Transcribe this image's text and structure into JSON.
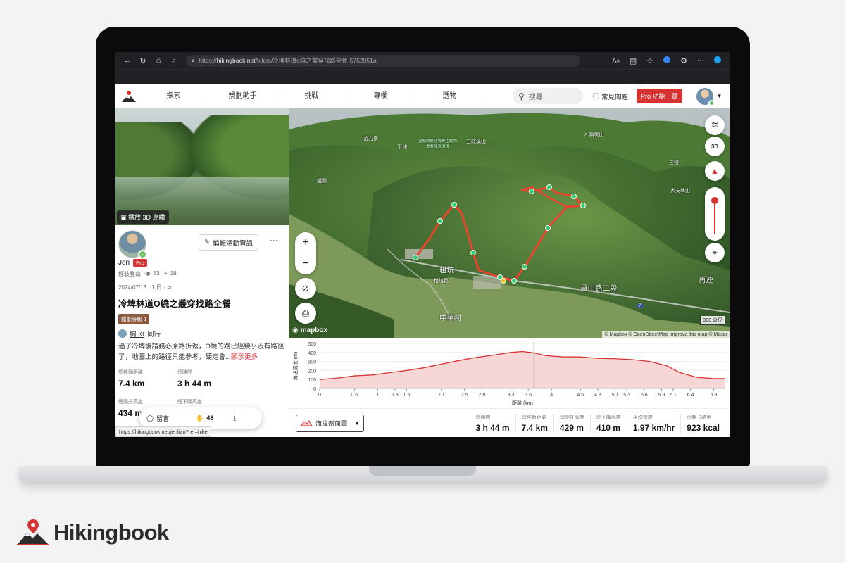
{
  "browser": {
    "url_prefix": "https://",
    "url_host": "hikingbook.net",
    "url_path": "/hikes/冷埤林道o繞之叢穿找路全餐-5752951a",
    "icons": [
      "back-icon",
      "reload-icon",
      "home-icon",
      "search-icon",
      "lock-icon",
      "read-aloud-icon",
      "immersive-reader-icon",
      "favorite-icon",
      "copilot-icon",
      "extensions-icon",
      "more-icon",
      "edge-icon"
    ]
  },
  "nav": {
    "items": [
      "探索",
      "規劃助手",
      "挑戰",
      "專欄",
      "選物"
    ],
    "search_placeholder": "搜尋",
    "faq": "常見問題",
    "pro_button": "Pro 功能一覽"
  },
  "hike": {
    "play_3d": "播放 3D 鳥瞰",
    "edit_button": "編輯活動資訊",
    "more": "···",
    "user_name": "Jen",
    "pro_tag": "Pro",
    "activity_type": "輕裝登山",
    "views": "53",
    "saves": "19",
    "date": "2024/07/13 · 1 日 ·",
    "title": "冷埤林道O繞之叢穿找路全餐",
    "level_tag": "體能等級 1",
    "companion_name": "胸 Kf",
    "companion_suffix": "同行",
    "description": "過了冷埤後請務必原路折返，O繞的路已經幾乎沒有路徑了，地圖上的路徑只能參考，硬走會...",
    "show_more": "顯示更多",
    "stats": [
      {
        "label": "總移動距離",
        "value": "7.4 km"
      },
      {
        "label": "總時間",
        "value": "3 h 44 m"
      },
      {
        "label": "總爬升高度",
        "value": "434 m"
      },
      {
        "label": "總下降高度",
        "value": ""
      }
    ],
    "comment_label": "留言",
    "claps": "48",
    "status_url": "https://hikingbook.net/jenliao?ref=hike"
  },
  "map": {
    "labels": [
      "苗力寮",
      "下埔",
      "宜蘭縣雙連埤野生動物重要棲息環境",
      "三歧溪山",
      "組縣",
      "X 鍋炭山",
      "三巒",
      "大安埤山",
      "粗坑",
      "粗坑路",
      "中華村",
      "員山路二段",
      "再連",
      "7"
    ],
    "attribution": "© Mapbox © OpenStreetMap  Improve this map © Maxar",
    "scale": "300 公尺",
    "brand": "mapbox",
    "zoom_in": "+",
    "zoom_out": "−",
    "ctrl_3d": "3D"
  },
  "chart_data": {
    "type": "area",
    "xlabel": "距離 (km)",
    "ylabel": "海拔高度 (m)",
    "ylim": [
      0,
      500
    ],
    "xlim": [
      0,
      7.0
    ],
    "x_ticks": [
      "0",
      "0.6",
      "1",
      "1.3",
      "1.5",
      "2.1",
      "2.5",
      "2.8",
      "3.3",
      "3.6",
      "4",
      "4.5",
      "4.8",
      "5.1",
      "5.3",
      "5.6",
      "5.9",
      "6.1",
      "6.4",
      "6.8"
    ],
    "y_ticks": [
      "0",
      "100",
      "200",
      "300",
      "400",
      "500"
    ],
    "x": [
      0,
      0.3,
      0.6,
      0.9,
      1.2,
      1.5,
      1.8,
      2.1,
      2.4,
      2.7,
      3.0,
      3.3,
      3.5,
      3.7,
      3.9,
      4.2,
      4.5,
      4.8,
      5.1,
      5.4,
      5.7,
      6.0,
      6.2,
      6.5,
      6.8,
      7.0
    ],
    "y": [
      100,
      115,
      140,
      150,
      175,
      200,
      230,
      270,
      310,
      345,
      370,
      400,
      410,
      395,
      365,
      350,
      350,
      335,
      330,
      320,
      300,
      250,
      180,
      125,
      110,
      110
    ],
    "cursor_x": 3.7,
    "grid": true
  },
  "summary": {
    "profile_select": "海拔剖面圖",
    "stats": [
      {
        "label": "總時間",
        "value": "3 h 44 m"
      },
      {
        "label": "總移動距離",
        "value": "7.4 km"
      },
      {
        "label": "總爬升高度",
        "value": "429 m"
      },
      {
        "label": "總下降高度",
        "value": "410 m"
      },
      {
        "label": "平均速度",
        "value": "1.97 km/hr"
      },
      {
        "label": "消耗卡路里",
        "value": "923 kcal"
      }
    ]
  },
  "brand": {
    "name": "Hikingbook"
  },
  "colors": {
    "accent": "#d83333",
    "route": "#e8452f",
    "waypoint": "#2ecf6f",
    "elevation_fill": "#f6cfcf",
    "elevation_line": "#d83333"
  }
}
